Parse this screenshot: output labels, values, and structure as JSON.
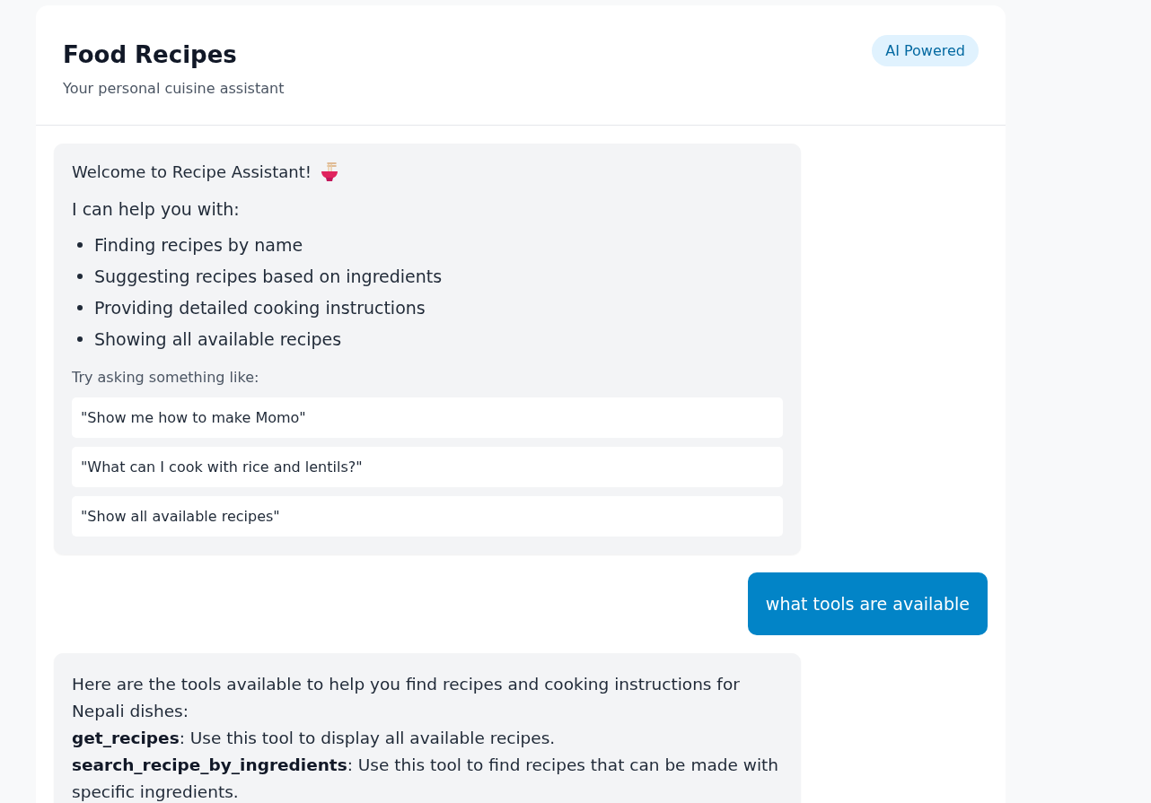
{
  "header": {
    "title": "Food Recipes",
    "subtitle": "Your personal cuisine assistant",
    "badge": "AI Powered"
  },
  "messages": [
    {
      "kind": "welcome",
      "title": "Welcome to Recipe Assistant!",
      "intro": "I can help you with:",
      "items": [
        "Finding recipes by name",
        "Suggesting recipes based on ingredients",
        "Providing detailed cooking instructions",
        "Showing all available recipes"
      ],
      "prompt_label": "Try asking something like:",
      "suggestions": [
        "\"Show me how to make Momo\"",
        "\"What can I cook with rice and lentils?\"",
        "\"Show all available recipes\""
      ]
    },
    {
      "kind": "user",
      "text": "what tools are available"
    },
    {
      "kind": "bot",
      "lines": [
        "Here are the tools available to help you find recipes and cooking instructions for Nepali dishes:",
        "**get_recipes**: Use this tool to display all available recipes.",
        "**search_recipe_by_ingredients**: Use this tool to find recipes that can be made with specific ingredients."
      ]
    }
  ]
}
